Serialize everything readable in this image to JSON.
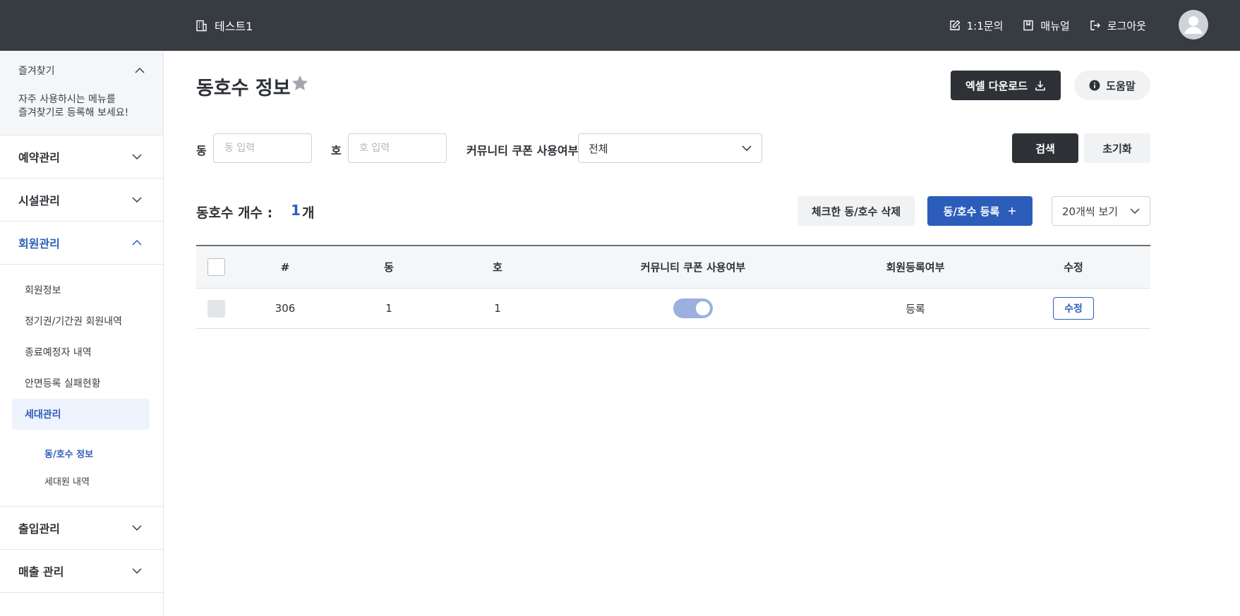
{
  "header": {
    "site_name": "테스트1",
    "links": [
      {
        "label": "1:1문의",
        "icon": "edit-icon"
      },
      {
        "label": "매뉴얼",
        "icon": "book-icon"
      },
      {
        "label": "로그아웃",
        "icon": "logout-icon"
      }
    ],
    "avatar_icon": "user-avatar-icon"
  },
  "sidebar": {
    "favorites": {
      "title": "즐겨찾기",
      "desc_line1": "자주 사용하시는 메뉴를",
      "desc_line2": "즐겨찾기로 등록해 보세요!"
    },
    "menus": [
      {
        "label": "예약관리",
        "expanded": false
      },
      {
        "label": "시설관리",
        "expanded": false
      },
      {
        "label": "회원관리",
        "expanded": true
      }
    ],
    "member_sub": [
      "회원정보",
      "정기권/기간권 회원내역",
      "종료예정자 내역",
      "안면등록 실패현황",
      "세대관리"
    ],
    "household_sub": [
      "동/호수 정보",
      "세대원 내역"
    ],
    "menus_after": [
      {
        "label": "출입관리",
        "expanded": false
      },
      {
        "label": "매출 관리",
        "expanded": false
      }
    ]
  },
  "page": {
    "title": "동호수 정보",
    "excel_button": "엑셀 다운로드",
    "help_button": "도움말"
  },
  "filters": {
    "dong_label": "동",
    "dong_placeholder": "동 입력",
    "ho_label": "호",
    "ho_placeholder": "호 입력",
    "coupon_label": "커뮤니티 쿠폰 사용여부",
    "coupon_value": "전체",
    "search_button": "검색",
    "reset_button": "초기화"
  },
  "summary": {
    "count_label": "동호수 개수 :",
    "count_value": "1",
    "count_unit": "개",
    "delete_button": "체크한 동/호수 삭제",
    "register_button": "동/호수 등록",
    "page_size": "20개씩 보기"
  },
  "table": {
    "headers": [
      "#",
      "동",
      "호",
      "커뮤니티 쿠폰 사용여부",
      "회원등록여부",
      "수정"
    ],
    "rows": [
      {
        "id": "306",
        "dong": "1",
        "ho": "1",
        "coupon_enabled": true,
        "registered": "등록",
        "edit": "수정"
      }
    ]
  },
  "colors": {
    "accent": "#2d5dbb",
    "topbar": "#373b42",
    "dark_button": "#2e3136"
  }
}
